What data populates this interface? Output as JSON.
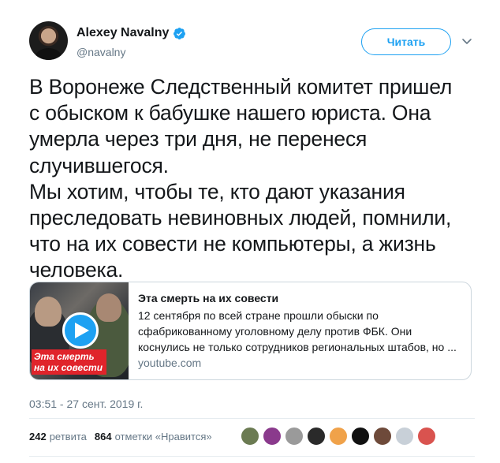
{
  "author": {
    "name": "Alexey Navalny",
    "handle": "@navalny",
    "verified": "verified-badge-icon"
  },
  "follow_label": "Читать",
  "tweet_text": "В Воронеже Следственный комитет пришел\nс обыском к бабушке нашего юриста. Она\nумерла через три дня, не перенеся\nслучившегося.\nМы хотим, чтобы те, кто дают указания\nпреследовать невиновных людей, помнили,\nчто на их совести не компьютеры, а жизнь\nчеловека.",
  "card": {
    "thumb_caption": "Эта смерть\nна их совести",
    "title": "Эта смерть на их совести",
    "description": "12 сентября по всей стране прошли обыски по сфабрикованному уголовному делу против ФБК. Они коснулись не только сотрудников региональных штабов, но ...",
    "domain": "youtube.com"
  },
  "timestamp": "03:51 - 27 сент. 2019 г.",
  "stats": {
    "retweets_count": "242",
    "retweets_label": "ретвита",
    "likes_count": "864",
    "likes_label": "отметки «Нравится»"
  },
  "likers": [
    {
      "color": "#6b7b52"
    },
    {
      "color": "#8a3a8c"
    },
    {
      "color": "#9a9a9a"
    },
    {
      "color": "#2a2a2a"
    },
    {
      "color": "#f0a24a"
    },
    {
      "color": "#111111"
    },
    {
      "color": "#6e4a3a"
    },
    {
      "color": "#c8d0d8"
    },
    {
      "color": "#d9534f"
    }
  ],
  "colors": {
    "accent": "#1da1f2",
    "text": "#14171a",
    "muted": "#657786",
    "border": "#ccd6dd"
  }
}
